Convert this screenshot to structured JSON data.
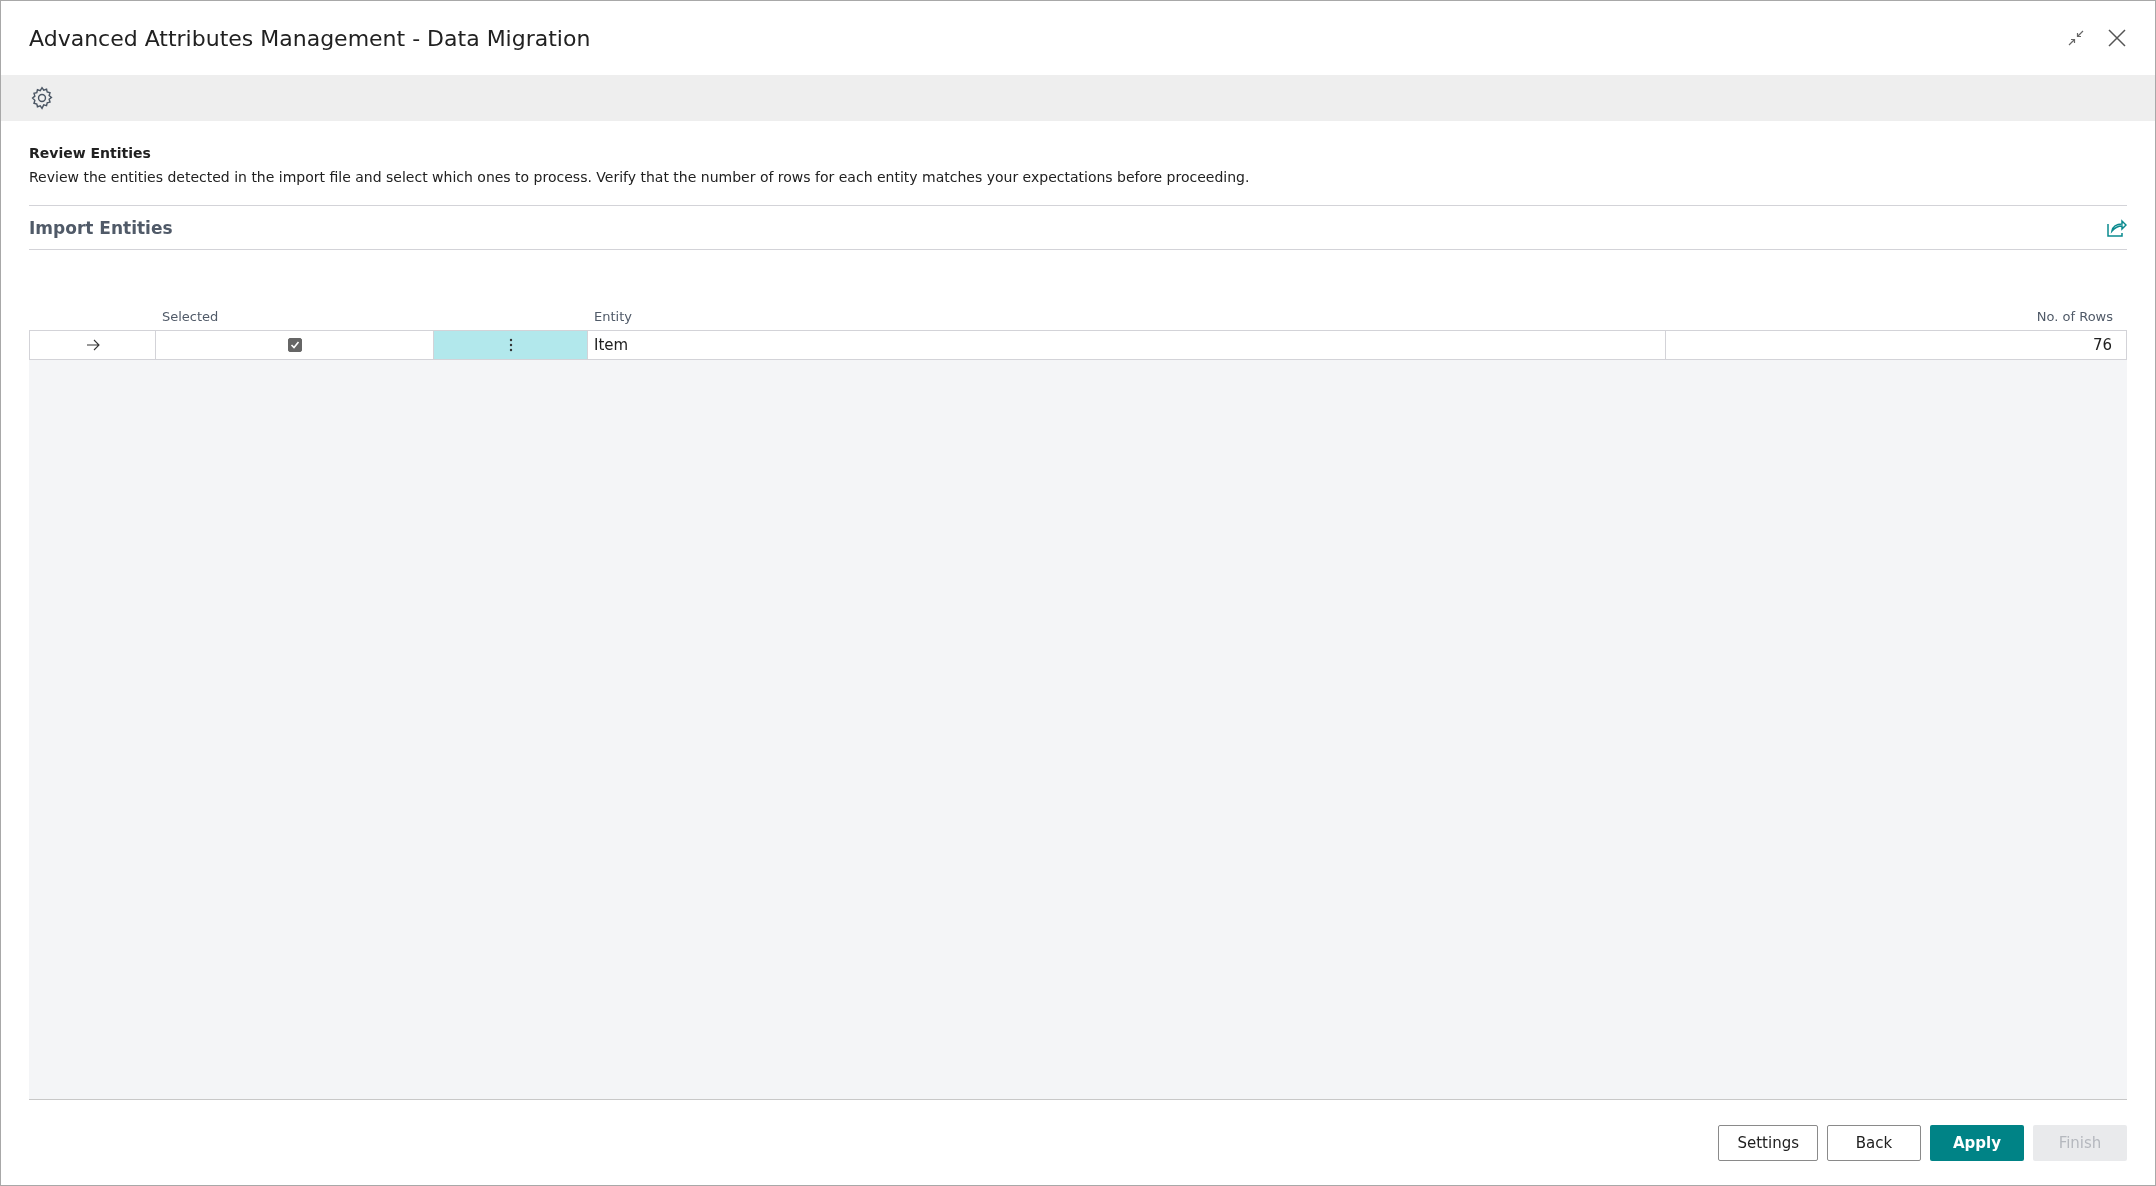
{
  "window": {
    "title": "Advanced Attributes Management - Data Migration"
  },
  "step": {
    "title": "Review Entities",
    "description": "Review the entities detected in the import file and select which ones to process. Verify that the number of rows for each entity matches your expectations before proceeding."
  },
  "part": {
    "title": "Import Entities",
    "columns": [
      "Selected",
      "Entity",
      "No. of Rows"
    ],
    "rows": [
      {
        "current": true,
        "checked": true,
        "entity": "Item",
        "rows": "76"
      }
    ]
  },
  "buttons": [
    {
      "label": "Settings",
      "kind": "default"
    },
    {
      "label": "Back",
      "kind": "default"
    },
    {
      "label": "Apply",
      "kind": "primary"
    },
    {
      "label": "Finish",
      "kind": "disabled"
    }
  ]
}
